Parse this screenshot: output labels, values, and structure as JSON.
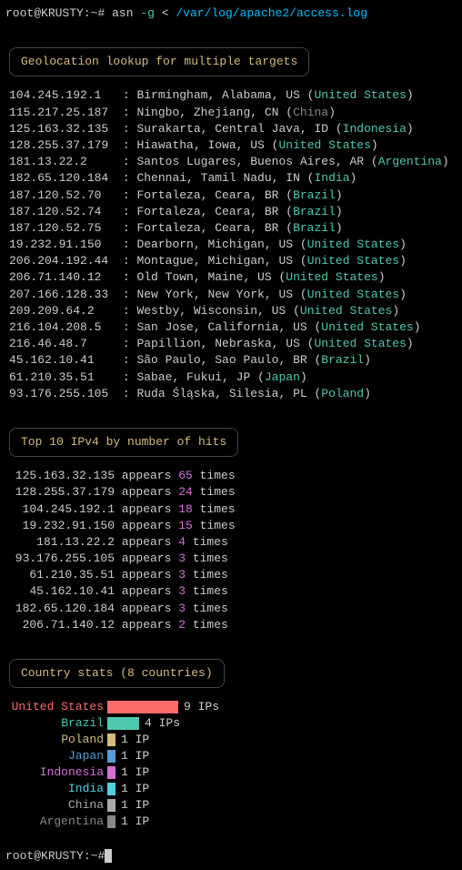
{
  "prompt": {
    "user": "root",
    "host": "KRUSTY",
    "path": "~",
    "symbol": "#",
    "command": "asn",
    "flag": "-g",
    "redir": "<",
    "file": "/var/log/apache2/access.log"
  },
  "sections": {
    "geo": {
      "title": "Geolocation lookup for multiple targets"
    },
    "top": {
      "title": "Top 10 IPv4 by number of hits"
    },
    "country": {
      "title": "Country stats (8 countries)"
    }
  },
  "geo": [
    {
      "ip": "104.245.192.1",
      "loc": "Birmingham, Alabama, US",
      "country": "United States",
      "grey": false
    },
    {
      "ip": "115.217.25.187",
      "loc": "Ningbo, Zhejiang, CN",
      "country": "China",
      "grey": true
    },
    {
      "ip": "125.163.32.135",
      "loc": "Surakarta, Central Java, ID",
      "country": "Indonesia",
      "grey": false
    },
    {
      "ip": "128.255.37.179",
      "loc": "Hiawatha, Iowa, US",
      "country": "United States",
      "grey": false
    },
    {
      "ip": "181.13.22.2",
      "loc": "Santos Lugares, Buenos Aires, AR",
      "country": "Argentina",
      "grey": false
    },
    {
      "ip": "182.65.120.184",
      "loc": "Chennai, Tamil Nadu, IN",
      "country": "India",
      "grey": false
    },
    {
      "ip": "187.120.52.70",
      "loc": "Fortaleza, Ceara, BR",
      "country": "Brazil",
      "grey": false
    },
    {
      "ip": "187.120.52.74",
      "loc": "Fortaleza, Ceara, BR",
      "country": "Brazil",
      "grey": false
    },
    {
      "ip": "187.120.52.75",
      "loc": "Fortaleza, Ceara, BR",
      "country": "Brazil",
      "grey": false
    },
    {
      "ip": "19.232.91.150",
      "loc": "Dearborn, Michigan, US",
      "country": "United States",
      "grey": false
    },
    {
      "ip": "206.204.192.44",
      "loc": "Montague, Michigan, US",
      "country": "United States",
      "grey": false
    },
    {
      "ip": "206.71.140.12",
      "loc": "Old Town, Maine, US",
      "country": "United States",
      "grey": false
    },
    {
      "ip": "207.166.128.33",
      "loc": "New York, New York, US",
      "country": "United States",
      "grey": false
    },
    {
      "ip": "209.209.64.2",
      "loc": "Westby, Wisconsin, US",
      "country": "United States",
      "grey": false
    },
    {
      "ip": "216.104.208.5",
      "loc": "San Jose, California, US",
      "country": "United States",
      "grey": false
    },
    {
      "ip": "216.46.48.7",
      "loc": "Papillion, Nebraska, US",
      "country": "United States",
      "grey": false
    },
    {
      "ip": "45.162.10.41",
      "loc": "São Paulo, Sao Paulo, BR",
      "country": "Brazil",
      "grey": false
    },
    {
      "ip": "61.210.35.51",
      "loc": "Sabae, Fukui, JP",
      "country": "Japan",
      "grey": false
    },
    {
      "ip": "93.176.255.105",
      "loc": "Ruda Śląska, Silesia, PL",
      "country": "Poland",
      "grey": false
    }
  ],
  "hits": [
    {
      "ip": "125.163.32.135",
      "count": "65"
    },
    {
      "ip": "128.255.37.179",
      "count": "24"
    },
    {
      "ip": "104.245.192.1",
      "count": "18"
    },
    {
      "ip": "19.232.91.150",
      "count": "15"
    },
    {
      "ip": "181.13.22.2",
      "count": "4"
    },
    {
      "ip": "93.176.255.105",
      "count": "3"
    },
    {
      "ip": "61.210.35.51",
      "count": "3"
    },
    {
      "ip": "45.162.10.41",
      "count": "3"
    },
    {
      "ip": "182.65.120.184",
      "count": "3"
    },
    {
      "ip": "206.71.140.12",
      "count": "2"
    }
  ],
  "words": {
    "appears": "appears",
    "times": "times",
    "ips": "IPs",
    "ip": "IP"
  },
  "stats": [
    {
      "name": "United States",
      "count": "9",
      "unit": "IPs",
      "cls": "us",
      "width": 78
    },
    {
      "name": "Brazil",
      "count": "4",
      "unit": "IPs",
      "cls": "br",
      "width": 35
    },
    {
      "name": "Poland",
      "count": "1",
      "unit": "IP",
      "cls": "pl",
      "width": 9
    },
    {
      "name": "Japan",
      "count": "1",
      "unit": "IP",
      "cls": "jp",
      "width": 9
    },
    {
      "name": "Indonesia",
      "count": "1",
      "unit": "IP",
      "cls": "id",
      "width": 9
    },
    {
      "name": "India",
      "count": "1",
      "unit": "IP",
      "cls": "in",
      "width": 9
    },
    {
      "name": "China",
      "count": "1",
      "unit": "IP",
      "cls": "cn",
      "width": 9
    },
    {
      "name": "Argentina",
      "count": "1",
      "unit": "IP",
      "cls": "ar",
      "width": 9
    }
  ]
}
